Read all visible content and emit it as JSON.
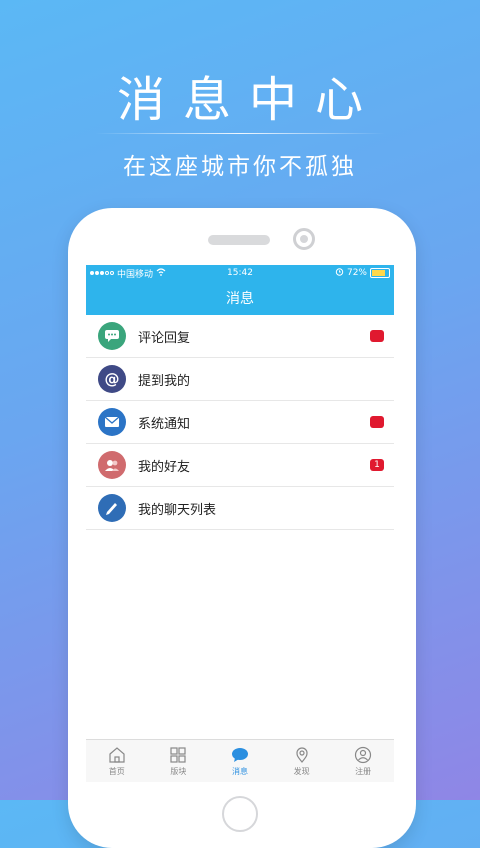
{
  "promo": {
    "title": "消息中心",
    "subtitle": "在这座城市你不孤独"
  },
  "statusbar": {
    "carrier": "中国移动",
    "time": "15:42",
    "battery": "72%"
  },
  "navbar": {
    "title": "消息"
  },
  "messages": [
    {
      "label": "评论回复",
      "icon": "comment-icon",
      "color": "#3aa57c",
      "badge": ""
    },
    {
      "label": "提到我的",
      "icon": "at-icon",
      "color": "#3f4a86",
      "badge": null
    },
    {
      "label": "系统通知",
      "icon": "mail-icon",
      "color": "#2b74c6",
      "badge": ""
    },
    {
      "label": "我的好友",
      "icon": "friends-icon",
      "color": "#d06b6e",
      "badge": "1"
    },
    {
      "label": "我的聊天列表",
      "icon": "pen-icon",
      "color": "#2f6db6",
      "badge": null
    }
  ],
  "tabs": [
    {
      "label": "首页",
      "icon": "home-icon",
      "active": false
    },
    {
      "label": "版块",
      "icon": "grid-icon",
      "active": false
    },
    {
      "label": "消息",
      "icon": "chat-bubble-icon",
      "active": true
    },
    {
      "label": "发现",
      "icon": "location-icon",
      "active": false
    },
    {
      "label": "注册",
      "icon": "user-icon",
      "active": false
    }
  ],
  "colors": {
    "accent": "#2eb4ec",
    "badge": "#e0192f",
    "tab_active": "#2b8fe0"
  }
}
